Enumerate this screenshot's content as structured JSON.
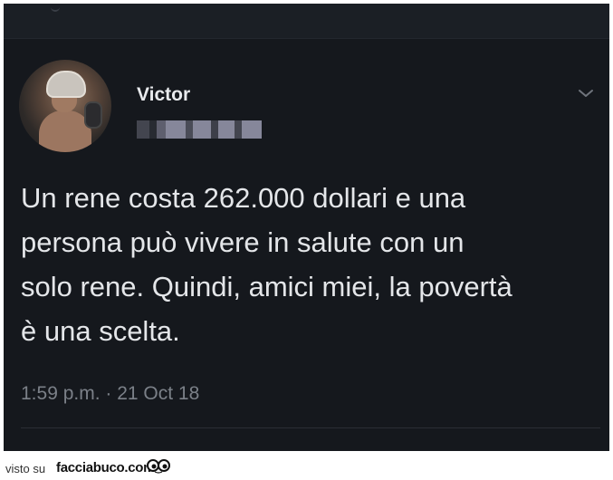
{
  "tweet": {
    "display_name": "Victor",
    "handle_obscured": true,
    "text_lines": [
      "Un rene costa 262.000 dollari e una",
      "persona può vivere in salute con un",
      "solo rene. Quindi, amici miei, la povertà",
      "è una scelta."
    ],
    "timestamp": "1:59 p.m. · 21 Oct 18"
  },
  "icons": {
    "menu": "chevron-down-icon",
    "watermark_eyes": "eyes-icon"
  },
  "footer": {
    "visto_su": "visto su",
    "site": "facciabuco.com"
  },
  "colors": {
    "background": "#15181d",
    "text": "#e4e6e9",
    "muted": "#7b8088"
  }
}
